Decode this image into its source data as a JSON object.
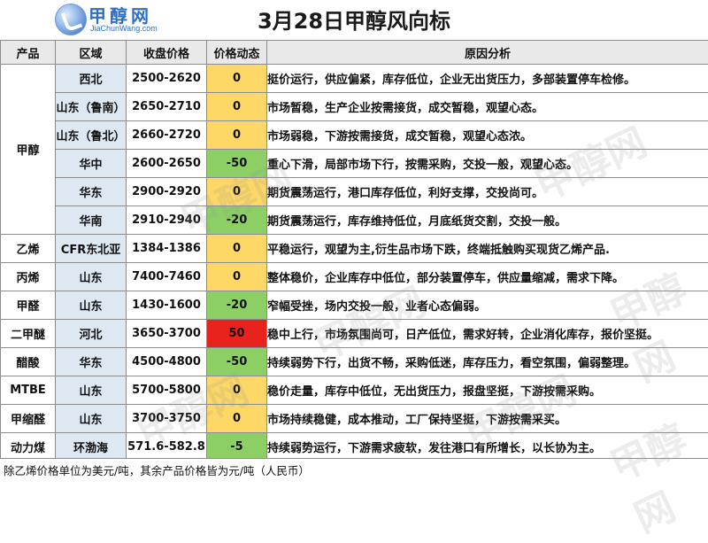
{
  "header": {
    "logo_cn": "甲醇网",
    "logo_en": "JiaChunWang.com",
    "title": "3月28日甲醇风向标"
  },
  "columns": [
    "产品",
    "区域",
    "收盘价格",
    "价格动态",
    "原因分析"
  ],
  "groups": [
    {
      "product": "甲醇",
      "rows": [
        {
          "region": "西北",
          "price": "2500-2620",
          "change": "0",
          "change_color": "#fdd866",
          "reason": "挺价运行，供应偏紧，库存低位，企业无出货压力，多部装置停车检修。"
        },
        {
          "region": "山东（鲁南）",
          "price": "2650-2710",
          "change": "0",
          "change_color": "#fdd866",
          "reason": "市场暂稳，生产企业按需接货，成交暂稳，观望心态。"
        },
        {
          "region": "山东（鲁北）",
          "price": "2660-2720",
          "change": "0",
          "change_color": "#fdd866",
          "reason": "市场弱稳，下游按需接货，成交暂稳，观望心态浓。"
        },
        {
          "region": "华中",
          "price": "2600-2650",
          "change": "-50",
          "change_color": "#8cd065",
          "reason": "重心下滑，局部市场下行，按需采购，交投一般，观望心态。"
        },
        {
          "region": "华东",
          "price": "2900-2920",
          "change": "0",
          "change_color": "#fdd866",
          "reason": "期货震荡运行，港口库存低位，利好支撑，交投尚可。"
        },
        {
          "region": "华南",
          "price": "2910-2940",
          "change": "-20",
          "change_color": "#8cd065",
          "reason": "期货震荡运行，库存维持低位，月底纸货交割，交投一般。"
        }
      ]
    },
    {
      "product": "乙烯",
      "rows": [
        {
          "region": "CFR东北亚",
          "price": "1384-1386",
          "change": "0",
          "change_color": "#fdd866",
          "reason": "平稳运行，观望为主,衍生品市场下跌，终端抵触购买现货乙烯产品."
        }
      ]
    },
    {
      "product": "丙烯",
      "rows": [
        {
          "region": "山东",
          "price": "7400-7460",
          "change": "0",
          "change_color": "#fdd866",
          "reason": "整体稳价，企业库存中低位，部分装置停车，供应量缩减，需求下降。"
        }
      ]
    },
    {
      "product": "甲醛",
      "rows": [
        {
          "region": "山东",
          "price": "1430-1600",
          "change": "-20",
          "change_color": "#8cd065",
          "reason": "窄幅受挫，场内交投一般，业者心态偏弱。"
        }
      ]
    },
    {
      "product": "二甲醚",
      "rows": [
        {
          "region": "河北",
          "price": "3650-3700",
          "change": "50",
          "change_color": "#e8231e",
          "reason": "稳中上行，市场氛围尚可，日产低位，需求好转，企业消化库存，报价坚挺。"
        }
      ]
    },
    {
      "product": "醋酸",
      "rows": [
        {
          "region": "华东",
          "price": "4500-4800",
          "change": "-50",
          "change_color": "#8cd065",
          "reason": "持续弱势下行，出货不畅，采购低迷，库存压力，看空氛围，偏弱整理。"
        }
      ]
    },
    {
      "product": "MTBE",
      "rows": [
        {
          "region": "山东",
          "price": "5700-5800",
          "change": "0",
          "change_color": "#fdd866",
          "reason": "稳价走量，库存中低位，无出货压力，报盘坚挺，下游按需采购。"
        }
      ]
    },
    {
      "product": "甲缩醛",
      "rows": [
        {
          "region": "山东",
          "price": "3700-3750",
          "change": "0",
          "change_color": "#fdd866",
          "reason": "市场持续稳健，成本推动，工厂保持坚挺，下游按需采买。"
        }
      ]
    },
    {
      "product": "动力煤",
      "rows": [
        {
          "region": "环渤海",
          "price": "571.6-582.8",
          "change": "-5",
          "change_color": "#8cd065",
          "reason": "持续弱势运行，下游需求疲软，发往港口有所增长，以长协为主。"
        }
      ]
    }
  ],
  "footer": {
    "note": "除乙烯价格单位为美元/吨，其余产品价格皆为元/吨（人民币）"
  }
}
